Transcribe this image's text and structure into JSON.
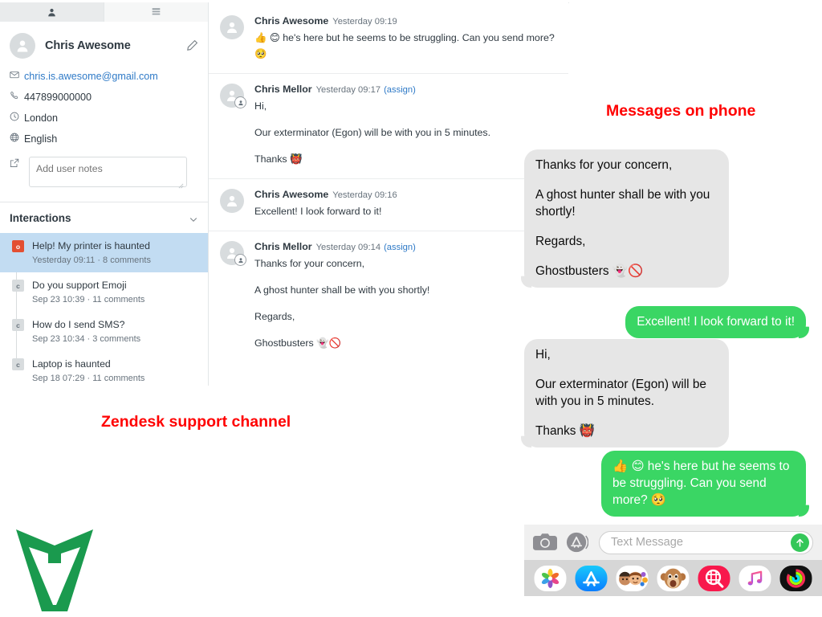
{
  "zendesk": {
    "tabs": [
      {
        "name": "user-tab",
        "icon": "person-icon",
        "active": true
      },
      {
        "name": "apps-tab",
        "icon": "list-icon",
        "active": false
      }
    ],
    "user": {
      "name": "Chris Awesome",
      "edit_icon": "pencil-icon",
      "fields": [
        {
          "icon": "envelope-icon",
          "value": "chris.is.awesome@gmail.com",
          "link": true
        },
        {
          "icon": "phone-icon",
          "value": "447899000000",
          "link": false
        },
        {
          "icon": "clock-icon",
          "value": "London",
          "link": false
        },
        {
          "icon": "globe-icon",
          "value": "English",
          "link": false
        }
      ],
      "notes_icon": "external-link-icon",
      "notes_placeholder": "Add user notes",
      "notes_value": ""
    },
    "interactions": {
      "title": "Interactions",
      "collapse_icon": "chevron-down-icon",
      "items": [
        {
          "status": "o",
          "state": "open",
          "title": "Help! My printer is haunted",
          "meta": "Yesterday 09:11 · 8 comments",
          "selected": true
        },
        {
          "status": "c",
          "state": "closed",
          "title": "Do you support Emoji",
          "meta": "Sep 23 10:39 · 11 comments",
          "selected": false
        },
        {
          "status": "c",
          "state": "closed",
          "title": "How do I send SMS?",
          "meta": "Sep 23 10:34 · 3 comments",
          "selected": false
        },
        {
          "status": "c",
          "state": "closed",
          "title": "Laptop is haunted",
          "meta": "Sep 18 07:29 · 11 comments",
          "selected": false
        }
      ]
    },
    "thread": [
      {
        "author": "Chris Awesome",
        "time": "Yesterday 09:19",
        "assign": "",
        "is_agent": false,
        "lines": [
          "👍 😊 he's here but he seems to be struggling. Can you send more? 🥺"
        ]
      },
      {
        "author": "Chris Mellor",
        "time": "Yesterday 09:17",
        "assign": "(assign)",
        "is_agent": true,
        "lines": [
          "Hi,",
          "Our exterminator (Egon) will be with you in 5 minutes.",
          "Thanks 👹"
        ]
      },
      {
        "author": "Chris Awesome",
        "time": "Yesterday 09:16",
        "assign": "",
        "is_agent": false,
        "lines": [
          "Excellent! I look forward to it!"
        ]
      },
      {
        "author": "Chris Mellor",
        "time": "Yesterday 09:14",
        "assign": "(assign)",
        "is_agent": true,
        "lines": [
          "Thanks for your concern,",
          "A ghost hunter shall be with you shortly!",
          "Regards,",
          "Ghostbusters 👻🚫"
        ]
      }
    ]
  },
  "phone": {
    "bubbles": [
      {
        "dir": "in",
        "lines": [
          "Thanks for your concern,",
          "A ghost hunter shall be with you shortly!",
          "Regards,",
          "Ghostbusters 👻🚫"
        ]
      },
      {
        "dir": "out",
        "lines": [
          "Excellent! I look forward to it!"
        ]
      },
      {
        "dir": "in",
        "lines": [
          "Hi,",
          "Our exterminator (Egon) will be with you in 5 minutes.",
          "Thanks 👹"
        ]
      },
      {
        "dir": "out",
        "lines": [
          "👍 😊 he's here but he seems to be struggling. Can you send more? 🥺"
        ]
      }
    ],
    "input": {
      "camera_icon": "camera-icon",
      "appstore_icon": "app-store-icon",
      "placeholder": "Text Message",
      "value": "",
      "send_icon": "send-arrow-icon"
    },
    "app_drawer": [
      {
        "name": "photos-app-icon"
      },
      {
        "name": "app-store-app-icon"
      },
      {
        "name": "memoji-app-icon"
      },
      {
        "name": "animoji-app-icon"
      },
      {
        "name": "images-search-app-icon"
      },
      {
        "name": "music-app-icon"
      },
      {
        "name": "activity-app-icon"
      }
    ]
  },
  "annotations": {
    "zendesk_label": "Zendesk support channel",
    "phone_label": "Messages on phone",
    "color": "#ff0000"
  },
  "logo": {
    "name": "v-logo",
    "color": "#1a9a4e"
  }
}
